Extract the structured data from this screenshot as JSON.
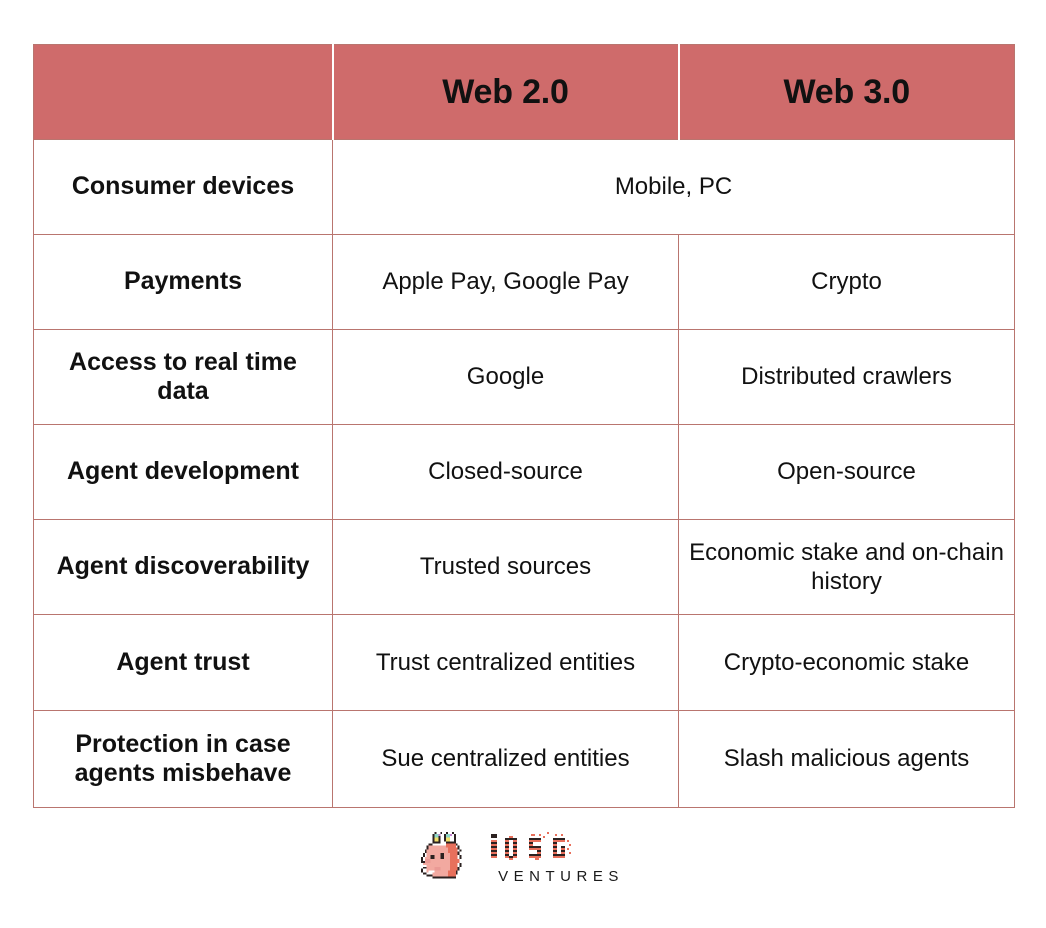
{
  "table": {
    "columns": [
      "",
      "Web 2.0",
      "Web 3.0"
    ],
    "header": {
      "corner": "",
      "web2": "Web 2.0",
      "web3": "Web 3.0"
    },
    "rows": [
      {
        "label": "Consumer devices",
        "merged": true,
        "merged_value": "Mobile, PC",
        "web2": "Mobile, PC",
        "web3": "Mobile, PC"
      },
      {
        "label": "Payments",
        "merged": false,
        "web2": "Apple Pay, Google Pay",
        "web3": "Crypto"
      },
      {
        "label": "Access to real time data",
        "merged": false,
        "web2": "Google",
        "web3": "Distributed crawlers"
      },
      {
        "label": "Agent development",
        "merged": false,
        "web2": "Closed-source",
        "web3": "Open-source"
      },
      {
        "label": "Agent discoverability",
        "merged": false,
        "web2": "Trusted sources",
        "web3": "Economic stake and on-chain history"
      },
      {
        "label": "Agent trust",
        "merged": false,
        "web2": "Trust centralized entities",
        "web3": "Crypto-economic stake"
      },
      {
        "label": "Protection in case agents misbehave",
        "merged": false,
        "web2": "Sue centralized entities",
        "web3": "Slash malicious agents"
      }
    ]
  },
  "logo": {
    "mark": "llama-head-pixel-icon",
    "wordmark": "IOSG",
    "tagline": "VENTURES"
  },
  "colors": {
    "header_bg": "#cf6b6b",
    "border": "#b9756f",
    "text": "#111111",
    "header_text": "#ffffff",
    "logo_salmon": "#e8705c",
    "logo_dark": "#2b2120",
    "page_bg": "#ffffff"
  }
}
